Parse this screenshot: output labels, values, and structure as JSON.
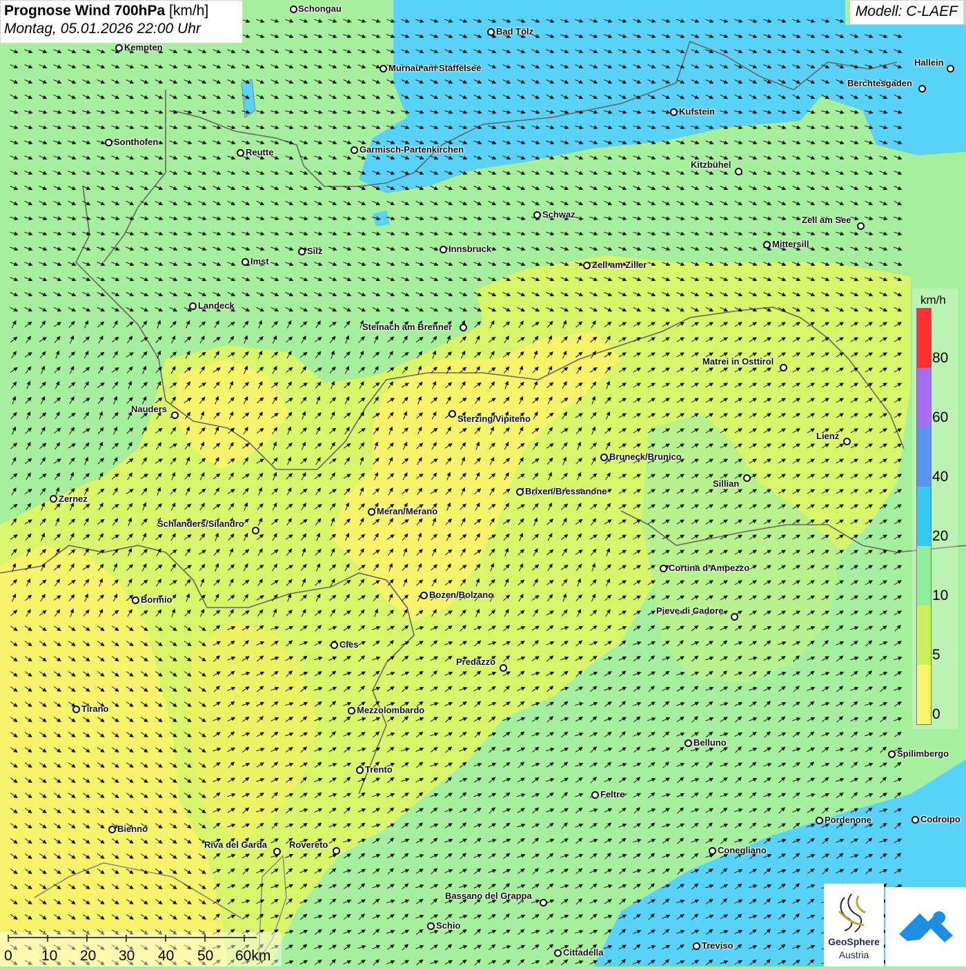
{
  "title": {
    "bold": "Prognose Wind 700hPa",
    "unit": "[km/h]",
    "datetime": "Montag, 05.01.2026 22:00 Uhr"
  },
  "model": "Modell: C-LAEF",
  "legend": {
    "unit": "km/h",
    "ticks": [
      "80",
      "60",
      "40",
      "20",
      "10",
      "5",
      "0"
    ],
    "colors": [
      "#ff3030",
      "#a66cf2",
      "#5b93f2",
      "#38c8f5",
      "#8ff09a",
      "#ccf25a",
      "#fbf56a"
    ]
  },
  "scale": {
    "labels": [
      "0",
      "10",
      "20",
      "30",
      "40",
      "50",
      "60km"
    ]
  },
  "logos": {
    "geosphere_line1": "GeoSphere",
    "geosphere_line2": "Austria"
  },
  "cities": [
    {
      "name": "Schongau"
    },
    {
      "name": "Bad Tölz"
    },
    {
      "name": "Kempten"
    },
    {
      "name": "Murnau am Staffelsee"
    },
    {
      "name": "Hallein"
    },
    {
      "name": "Berchtesgaden"
    },
    {
      "name": "Kufstein"
    },
    {
      "name": "Sonthofen"
    },
    {
      "name": "Reutte"
    },
    {
      "name": "Garmisch-Partenkirchen"
    },
    {
      "name": "Kitzbühel"
    },
    {
      "name": "Schwaz"
    },
    {
      "name": "Zell am See"
    },
    {
      "name": "Mittersill"
    },
    {
      "name": "Innsbruck"
    },
    {
      "name": "Silz"
    },
    {
      "name": "Imst"
    },
    {
      "name": "Zell am Ziller"
    },
    {
      "name": "Landeck"
    },
    {
      "name": "Steinach am Brenner"
    },
    {
      "name": "Matrei in Osttirol"
    },
    {
      "name": "Nauders"
    },
    {
      "name": "Sterzing/Vipiteno"
    },
    {
      "name": "Lienz"
    },
    {
      "name": "Bruneck/Brunico"
    },
    {
      "name": "Sillian"
    },
    {
      "name": "Zernez"
    },
    {
      "name": "Brixen/Bressanone"
    },
    {
      "name": "Meran/Merano"
    },
    {
      "name": "Schlanders/Silandro"
    },
    {
      "name": "Cortina d'Ampezzo"
    },
    {
      "name": "Bozen/Bolzano"
    },
    {
      "name": "Bormio"
    },
    {
      "name": "Pieve di Cadore"
    },
    {
      "name": "Cles"
    },
    {
      "name": "Predazzo"
    },
    {
      "name": "Tirano"
    },
    {
      "name": "Mezzolombardo"
    },
    {
      "name": "Belluno"
    },
    {
      "name": "Spilimbergo"
    },
    {
      "name": "Trento"
    },
    {
      "name": "Feltre"
    },
    {
      "name": "Pordenone"
    },
    {
      "name": "Codroipo"
    },
    {
      "name": "Bienno"
    },
    {
      "name": "Riva del Garda"
    },
    {
      "name": "Rovereto"
    },
    {
      "name": "Conegliano"
    },
    {
      "name": "Bassano del Grappa"
    },
    {
      "name": "Schio"
    },
    {
      "name": "Treviso"
    },
    {
      "name": "Cittadella"
    }
  ]
}
